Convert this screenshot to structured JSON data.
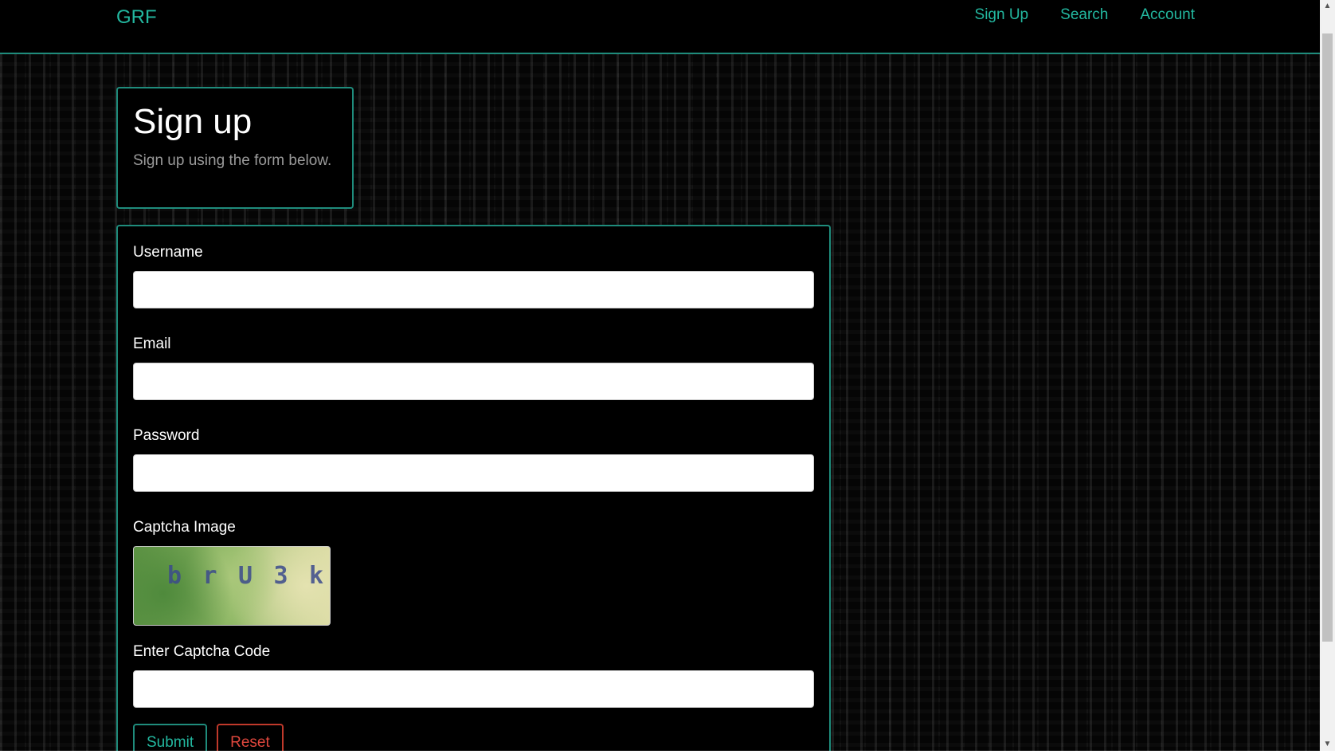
{
  "navbar": {
    "brand": "GRF",
    "links": [
      "Sign Up",
      "Search",
      "Account"
    ]
  },
  "header": {
    "title": "Sign up",
    "subtitle": "Sign up using the form below."
  },
  "form": {
    "username_label": "Username",
    "email_label": "Email",
    "password_label": "Password",
    "captcha_image_label": "Captcha Image",
    "captcha_text": "b r U 3 k",
    "captcha_code_label": "Enter Captcha Code",
    "submit_label": "Submit",
    "reset_label": "Reset"
  },
  "colors": {
    "accent": "#23b8a0",
    "danger": "#e0473d",
    "background": "#000000"
  }
}
